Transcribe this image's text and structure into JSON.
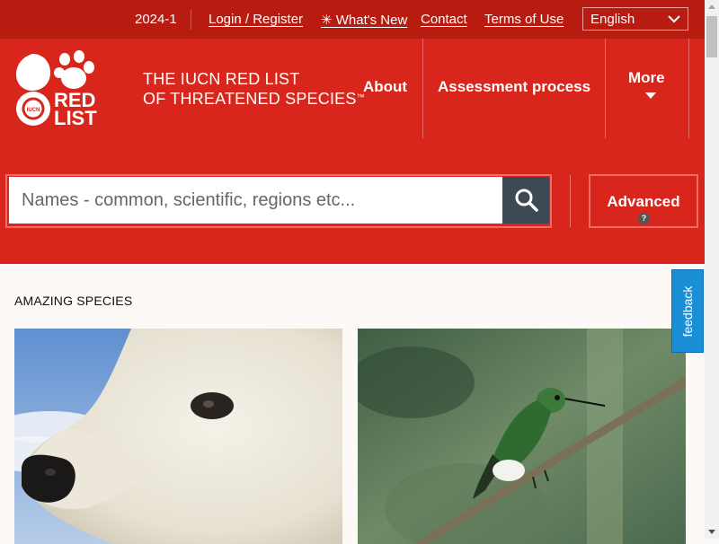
{
  "topbar": {
    "version": "2024-1",
    "login": "Login / Register",
    "whats_new": "What's New",
    "contact": "Contact",
    "terms": "Terms of Use",
    "language": "English"
  },
  "header": {
    "logo_text_1": "RED",
    "logo_text_2": "LIST",
    "logo_badge": "IUCN",
    "brand_line1": "THE IUCN RED LIST",
    "brand_line2": "OF THREATENED SPECIES",
    "brand_tm": "™",
    "nav": {
      "about": "About",
      "assessment": "Assessment process",
      "more": "More"
    }
  },
  "search": {
    "placeholder": "Names - common, scientific, regions etc...",
    "advanced": "Advanced",
    "help": "?"
  },
  "main": {
    "section_title": "AMAZING SPECIES"
  },
  "feedback": "feedback",
  "colors": {
    "topbar": "#b81b10",
    "header": "#d9261c",
    "search_button": "#3d4a53",
    "feedback": "#1a8fd6"
  }
}
